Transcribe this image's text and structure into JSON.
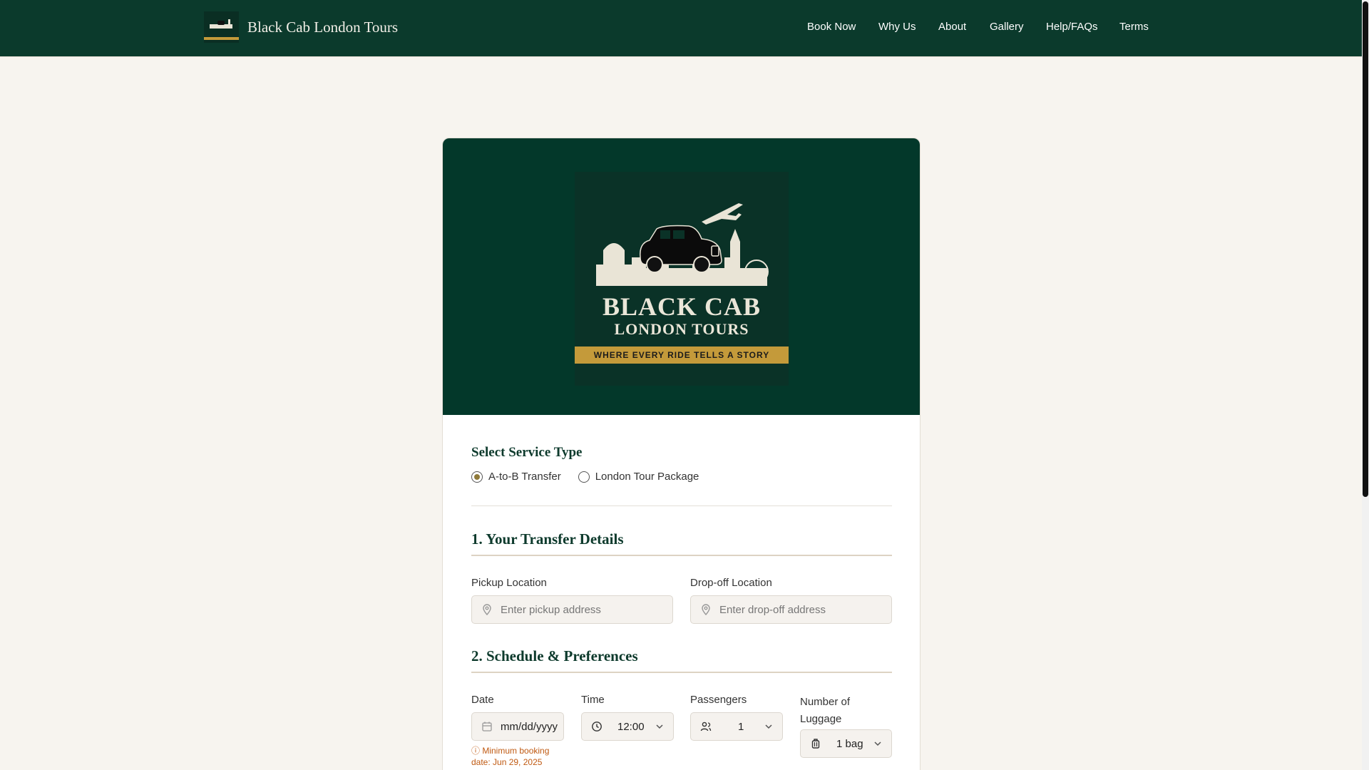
{
  "header": {
    "brand_name": "Black Cab London Tours",
    "nav": [
      "Book Now",
      "Why Us",
      "About",
      "Gallery",
      "Help/FAQs",
      "Terms"
    ]
  },
  "hero_logo": {
    "title_line1": "BLACK CAB",
    "title_line2": "LONDON TOURS",
    "tagline": "WHERE EVERY RIDE TELLS A STORY"
  },
  "service": {
    "title": "Select Service Type",
    "options": [
      "A-to-B Transfer",
      "London Tour Package"
    ],
    "selected": "A-to-B Transfer"
  },
  "transfer": {
    "title": "1. Your Transfer Details",
    "pickup_label": "Pickup Location",
    "pickup_placeholder": "Enter pickup address",
    "dropoff_label": "Drop-off Location",
    "dropoff_placeholder": "Enter drop-off address"
  },
  "schedule": {
    "title": "2. Schedule & Preferences",
    "date_label": "Date",
    "date_value": "mm/dd/yyyy",
    "date_hint": "Minimum booking date: Jun 29, 2025",
    "time_label": "Time",
    "time_value": "12:00",
    "passengers_label": "Passengers",
    "passengers_value": "1",
    "luggage_label": "Number of Luggage",
    "luggage_value": "1 bag"
  },
  "colors": {
    "header_bg": "#0b3a2c",
    "hero_bg": "#03382a",
    "gold": "#c49a3a",
    "warning": "#c05a12"
  }
}
